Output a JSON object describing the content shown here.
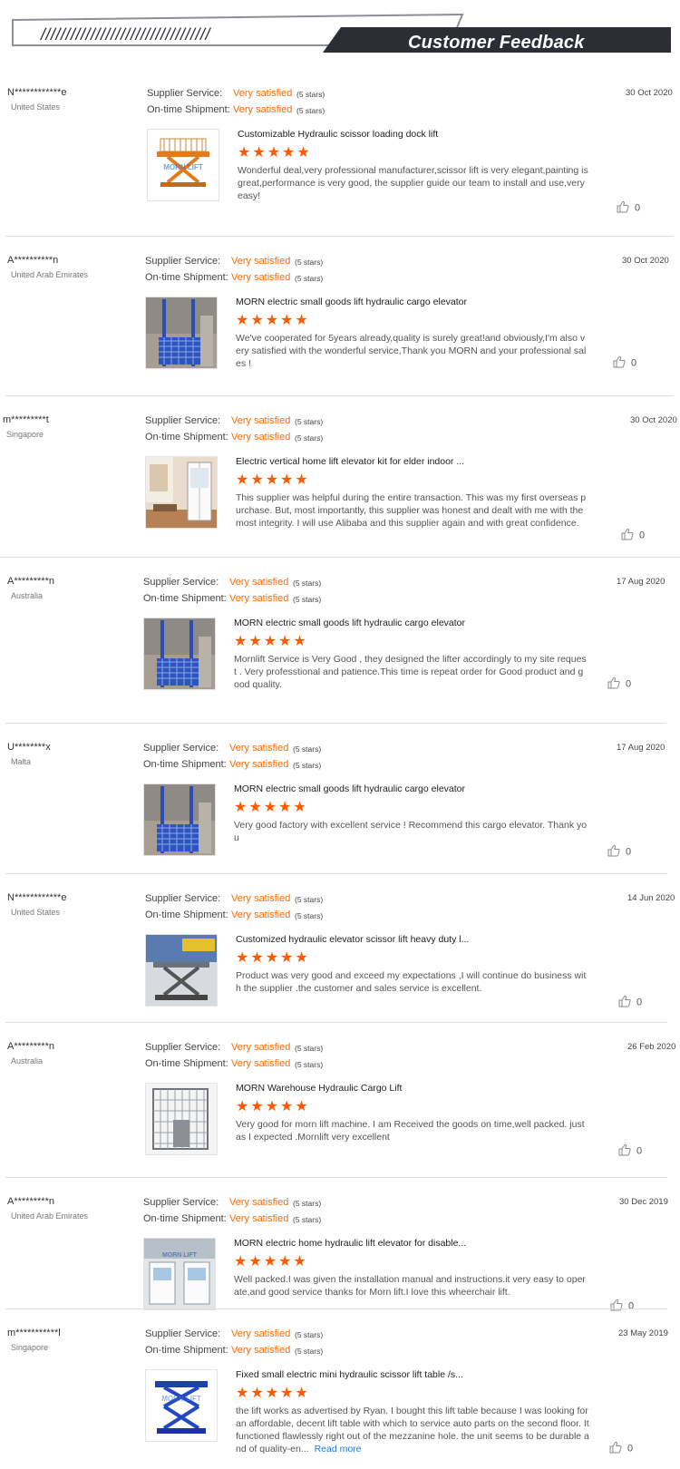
{
  "header": {
    "title": "Customer Feedback",
    "slashes": "//////////////////////////////////",
    "colors": {
      "banner_dark": "#2b2e34",
      "accent": "#ff6a00"
    }
  },
  "labels": {
    "supplier_service": "Supplier Service:",
    "ontime_shipment": "On-time Shipment:"
  },
  "reviews": [
    {
      "user": "N************e",
      "country": "United States",
      "date": "30 Oct 2020",
      "supplier_rating": "Very satisfied",
      "supplier_stars": "(5 stars)",
      "shipment_rating": "Very satisfied",
      "shipment_stars": "(5 stars)",
      "product": "Customizable Hydraulic scissor loading dock lift",
      "rating": 5,
      "comment": "Wonderful deal,very professional manufacturer,scissor lift is very elegant,painting is great,performance is very good, the supplier guide our team to install and use,very easy!",
      "likes": "0",
      "image": "orange-scissor-lift"
    },
    {
      "user": "A**********n",
      "country": "United Arab Emirates",
      "date": "30 Oct 2020",
      "supplier_rating": "Very satisfied",
      "supplier_stars": "(5 stars)",
      "shipment_rating": "Very satisfied",
      "shipment_stars": "(5 stars)",
      "product": "MORN electric small goods lift hydraulic cargo elevator",
      "rating": 5,
      "comment": "We've cooperated for 5years already,quality is surely great!and obviously,I'm also very satisfied with the wonderful service,Thank you MORN and your professional sales !",
      "likes": "0",
      "image": "blue-cargo-lift"
    },
    {
      "user": "m*********t",
      "country": "Singapore",
      "date": "30 Oct 2020",
      "supplier_rating": "Very satisfied",
      "supplier_stars": "(5 stars)",
      "shipment_rating": "Very satisfied",
      "shipment_stars": "(5 stars)",
      "product": "Electric vertical home lift elevator kit for elder indoor ...",
      "rating": 5,
      "comment": "This supplier was helpful during the entire transaction. This was my first overseas purchase. But, most importantly, this supplier was honest and dealt with me with the most integrity. I will use Alibaba and this supplier again and with great confidence.",
      "likes": "0",
      "image": "home-elevator"
    },
    {
      "user": "A*********n",
      "country": "Australia",
      "date": "17 Aug 2020",
      "supplier_rating": "Very satisfied",
      "supplier_stars": "(5 stars)",
      "shipment_rating": "Very satisfied",
      "shipment_stars": "(5 stars)",
      "product": "MORN electric small goods lift hydraulic cargo elevator",
      "rating": 5,
      "comment": "Mornlift Service is Very Good , they designed the lifter accordingly to my site request . Very professtional and patience.This time is repeat order for Good product and good quality.",
      "likes": "0",
      "image": "blue-cargo-lift"
    },
    {
      "user": "U********x",
      "country": "Malta",
      "date": "17 Aug 2020",
      "supplier_rating": "Very satisfied",
      "supplier_stars": "(5 stars)",
      "shipment_rating": "Very satisfied",
      "shipment_stars": "(5 stars)",
      "product": "MORN electric small goods lift hydraulic cargo elevator",
      "rating": 5,
      "comment": "Very good factory with excellent service ! Recommend this cargo elevator. Thank you",
      "likes": "0",
      "image": "blue-cargo-lift"
    },
    {
      "user": "N************e",
      "country": "United States",
      "date": "14 Jun 2020",
      "supplier_rating": "Very satisfied",
      "supplier_stars": "(5 stars)",
      "shipment_rating": "Very satisfied",
      "shipment_stars": "(5 stars)",
      "product": "Customized hydraulic elevator scissor lift heavy duty l...",
      "rating": 5,
      "comment": "Product was very good and exceed my expectations ,I will continue do business with the supplier .the customer and sales service is excellent.",
      "likes": "0",
      "image": "heavy-scissor-lift"
    },
    {
      "user": "A*********n",
      "country": "Australia",
      "date": "26 Feb 2020",
      "supplier_rating": "Very satisfied",
      "supplier_stars": "(5 stars)",
      "shipment_rating": "Very satisfied",
      "shipment_stars": "(5 stars)",
      "product": "MORN Warehouse Hydraulic Cargo Lift",
      "rating": 5,
      "comment": "Very good for morn lift machine. I am Received the goods on time,well packed. just as I expected .Mornlift very excellent",
      "likes": "0",
      "image": "warehouse-cage-lift"
    },
    {
      "user": "A*********n",
      "country": "United Arab Emirates",
      "date": "30 Dec 2019",
      "supplier_rating": "Very satisfied",
      "supplier_stars": "(5 stars)",
      "shipment_rating": "Very satisfied",
      "shipment_stars": "(5 stars)",
      "product": "MORN electric home hydraulic lift elevator for disable...",
      "rating": 5,
      "comment": "Well packed.I was given the installation manual and instructions.it very easy to operate,and good service thanks for Morn lift.I love this wheerchair lift.",
      "likes": "0",
      "image": "disabled-lift"
    },
    {
      "user": "m***********l",
      "country": "Singapore",
      "date": "23 May 2019",
      "supplier_rating": "Very satisfied",
      "supplier_stars": "(5 stars)",
      "shipment_rating": "Very satisfied",
      "shipment_stars": "(5 stars)",
      "product": "Fixed small electric mini hydraulic scissor lift table /s...",
      "rating": 5,
      "comment": "the lift works as advertised by Ryan. I bought this lift table because I was looking for an affordable, decent lift table with which to service auto parts on the second floor. It functioned flawlessly right out of the mezzanine hole. the unit seems to be durable and of quality-en...",
      "read_more": "Read more",
      "likes": "0",
      "image": "blue-scissor-table"
    }
  ]
}
